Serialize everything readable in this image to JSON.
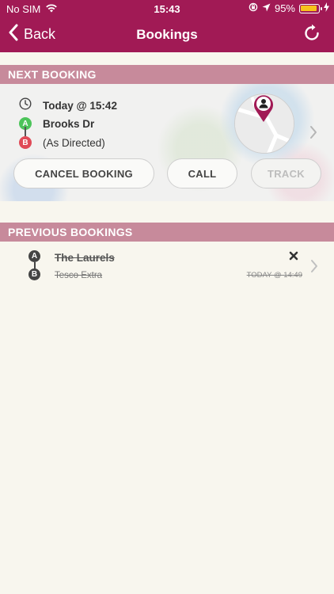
{
  "status_bar": {
    "carrier": "No SIM",
    "time": "15:43",
    "battery": "95%",
    "battery_level": 0.95
  },
  "nav": {
    "back_label": "Back",
    "title": "Bookings"
  },
  "next_booking": {
    "header": "NEXT BOOKING",
    "time_text": "Today @ 15:42",
    "pickup_badge": "A",
    "pickup": "Brooks Dr",
    "dropoff_badge": "B",
    "dropoff": "(As Directed)",
    "buttons": {
      "cancel": "CANCEL BOOKING",
      "call": "CALL",
      "track": "TRACK"
    }
  },
  "previous_bookings": {
    "header": "PREVIOUS BOOKINGS",
    "items": [
      {
        "from_badge": "A",
        "from": "The Laurels",
        "to_badge": "B",
        "to": "Tesco Extra",
        "time": "TODAY @ 14:49"
      }
    ]
  },
  "colors": {
    "brand": "#a11a55",
    "section_header": "#c78a9b",
    "pickup_green": "#4cc45a",
    "dropoff_red": "#e04a57"
  },
  "icons": [
    "back-chevron-icon",
    "refresh-icon",
    "clock-icon",
    "wifi-icon",
    "location-arrow-icon",
    "orientation-lock-icon",
    "close-icon",
    "chevron-right-icon"
  ]
}
